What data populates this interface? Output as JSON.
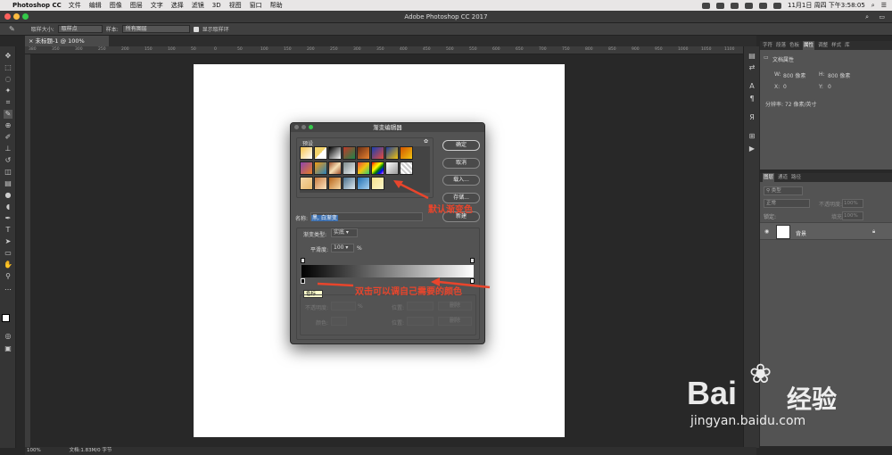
{
  "menubar": {
    "app": "Photoshop CC",
    "items": [
      "文件",
      "编辑",
      "图像",
      "图层",
      "文字",
      "选择",
      "滤镜",
      "3D",
      "视图",
      "窗口",
      "帮助"
    ],
    "clock": "11月1日 周四 下午3:58:05"
  },
  "window": {
    "title": "Adobe Photoshop CC 2017"
  },
  "options": {
    "sample_size_label": "取样大小:",
    "sample_size_value": "取样点",
    "sample_label": "样本:",
    "sample_value": "所有图层",
    "show_ring": "显示取样环"
  },
  "document": {
    "tab": "未标题-1 @ 100%(RGB/8*) *",
    "zoom": "100%",
    "doc_info": "文档:1.83M/0 字节"
  },
  "ruler": {
    "ticks": [
      "380",
      "350",
      "300",
      "250",
      "200",
      "150",
      "100",
      "50",
      "0",
      "50",
      "100",
      "150",
      "200",
      "250",
      "300",
      "350",
      "400",
      "450",
      "500",
      "550",
      "600",
      "650",
      "700",
      "750",
      "800",
      "850",
      "900",
      "950",
      "1000",
      "1050",
      "1100",
      "1150"
    ]
  },
  "dialog": {
    "title": "渐变编辑器",
    "presets_label": "预设",
    "ok": "确定",
    "cancel": "取消",
    "load": "载入...",
    "save": "存储...",
    "new": "新建",
    "name_label": "名称:",
    "name_value": "黑, 白渐变",
    "type_label": "渐变类型:",
    "type_value": "实底",
    "smooth_label": "平滑度:",
    "smooth_value": "100",
    "smooth_unit": "%",
    "stops_label": "色标",
    "opacity_label": "不透明度:",
    "opacity_unit": "%",
    "position_label": "位置:",
    "delete": "删除",
    "color_label": "颜色:",
    "position_label2": "位置:",
    "delete2": "删除",
    "tooltip": "色标"
  },
  "annotations": {
    "a1": "默认渐变色",
    "a2": "双击可以调自己需要的颜色"
  },
  "panels": {
    "props_tabs": [
      "字符",
      "段落",
      "色板",
      "属性",
      "调整",
      "样式",
      "库"
    ],
    "props_title": "文档属性",
    "w_label": "W:",
    "w_value": "800 像素",
    "h_label": "H:",
    "h_value": "800 像素",
    "x_label": "X:",
    "x_value": "0",
    "y_label": "Y:",
    "y_value": "0",
    "resolution": "分辨率: 72 像素/英寸",
    "layers_tabs": [
      "图层",
      "通道",
      "路径"
    ],
    "kind": "类型",
    "mode": "正常",
    "opacity_label": "不透明度:",
    "opacity_value": "100%",
    "lock_label": "锁定:",
    "fill_label": "填充:",
    "fill_value": "100%",
    "layer_name": "背景"
  },
  "watermark": {
    "brand": "Bai",
    "brand2": "经验",
    "url": "jingyan.baidu.com"
  }
}
